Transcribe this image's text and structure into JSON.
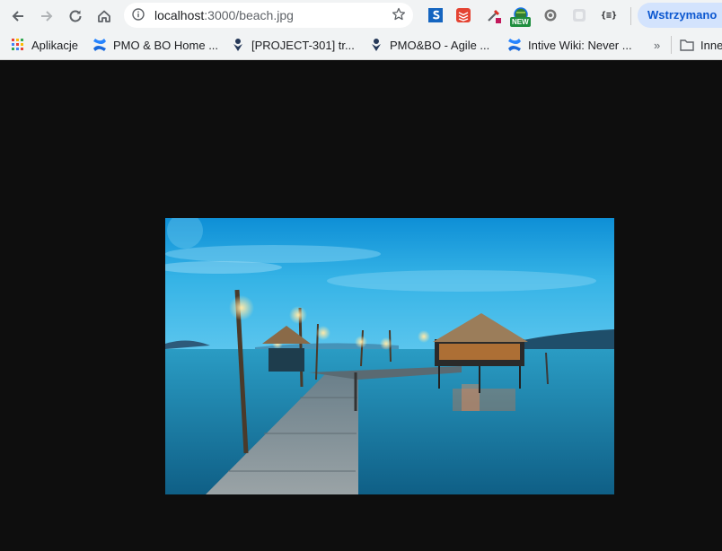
{
  "browser": {
    "url_host": "localhost",
    "url_path": ":3000/beach.jpg",
    "profile_status": "Wstrzymano",
    "badge_new": "NEW",
    "extensions": [
      "s-extension-icon",
      "todoist-icon",
      "color-picker-icon",
      "globe-icon",
      "gear-extension-icon",
      "frame-extension-icon",
      "json-extension-icon"
    ]
  },
  "bookmarks": {
    "items": [
      {
        "label": "Aplikacje",
        "icon": "apps-grid-icon"
      },
      {
        "label": "PMO & BO Home ...",
        "icon": "confluence-icon"
      },
      {
        "label": "[PROJECT-301] tr...",
        "icon": "jira-icon"
      },
      {
        "label": "PMO&BO - Agile ...",
        "icon": "jira-icon"
      },
      {
        "label": "Intive Wiki: Never ...",
        "icon": "confluence-icon"
      },
      {
        "label": "Inne",
        "icon": "folder-icon"
      }
    ],
    "overflow": "»"
  },
  "viewer": {
    "background": "#0e0e0e",
    "image_subject": "tropical pier at dusk"
  },
  "colors": {
    "accent": "#0b57d0",
    "confluence": "#1868db",
    "sky_top": "#1aa7e8",
    "sea": "#1f8fb3"
  }
}
